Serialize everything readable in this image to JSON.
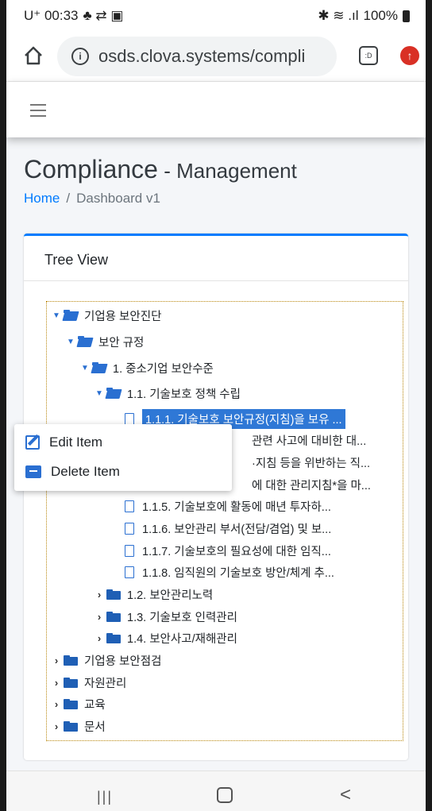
{
  "status_bar": {
    "carrier_time": "U⁺ 00:33",
    "left_icons": "♣ ⇄ ▣",
    "right_icons": "✱ ≋ .ıl",
    "battery": "100%"
  },
  "browser": {
    "url": "osds.clova.systems/compli",
    "tabs_label": ":D",
    "update_label": "↑"
  },
  "header": {
    "title_main": "Compliance",
    "title_sep": " - ",
    "title_sub": "Management",
    "breadcrumb_home": "Home",
    "breadcrumb_sep": "/",
    "breadcrumb_current": "Dashboard v1"
  },
  "card": {
    "title": "Tree View"
  },
  "tree": [
    {
      "label": "기업용 보안진단",
      "kind": "folder-open"
    },
    {
      "label": "보안 규정",
      "kind": "folder-open"
    },
    {
      "label": "1. 중소기업 보안수준",
      "kind": "folder-open"
    },
    {
      "label": "1.1. 기술보호 정책 수립",
      "kind": "folder-open"
    },
    {
      "label": "1.1.1. 기술보호 보안규정(지침)을 보유 ...",
      "kind": "file",
      "selected": true
    },
    {
      "label": "관련 사고에 대비한 대...",
      "kind": "file"
    },
    {
      "label": "·지침 등을 위반하는 직...",
      "kind": "file"
    },
    {
      "label": "에 대한 관리지침*을 마...",
      "kind": "file"
    },
    {
      "label": "1.1.5. 기술보호에 활동에 매년 투자하...",
      "kind": "file"
    },
    {
      "label": "1.1.6. 보안관리 부서(전담/겸업) 및 보...",
      "kind": "file"
    },
    {
      "label": "1.1.7. 기술보호의 필요성에 대한 임직...",
      "kind": "file"
    },
    {
      "label": "1.1.8. 임직원의 기술보호 방안/체계 추...",
      "kind": "file"
    },
    {
      "label": "1.2. 보안관리노력",
      "kind": "folder-closed"
    },
    {
      "label": "1.3. 기술보호 인력관리",
      "kind": "folder-closed"
    },
    {
      "label": "1.4. 보안사고/재해관리",
      "kind": "folder-closed"
    },
    {
      "label": "기업용 보안점검",
      "kind": "folder-closed"
    },
    {
      "label": "자원관리",
      "kind": "folder-closed"
    },
    {
      "label": "교육",
      "kind": "folder-closed"
    },
    {
      "label": "문서",
      "kind": "folder-closed"
    }
  ],
  "context_menu": {
    "edit_label": "Edit Item",
    "delete_label": "Delete Item"
  },
  "system_nav": {
    "recents": "|||",
    "back": "<"
  }
}
